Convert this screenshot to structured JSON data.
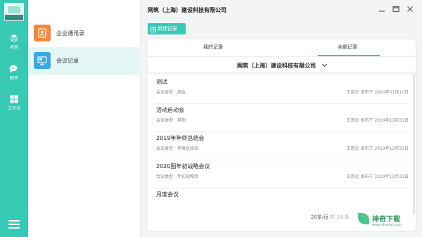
{
  "rail": {
    "items": [
      {
        "label": "项目",
        "icon": "layers-icon"
      },
      {
        "label": "聊天",
        "icon": "chat-icon"
      },
      {
        "label": "工作台",
        "icon": "grid-icon"
      }
    ],
    "menu_icon": "hamburger-icon",
    "accent": "#38c9b4"
  },
  "sidebar": {
    "items": [
      {
        "label": "企业通讯录",
        "icon": "contact-book-icon",
        "color": "#f0883e"
      },
      {
        "label": "会议记录",
        "icon": "meeting-icon",
        "color": "#3aa9e0"
      }
    ],
    "active_index": 1
  },
  "window": {
    "title": "网筑（上海）建设科技有限公司",
    "controls": {
      "minimize": "minimize-icon",
      "maximize": "maximize-icon",
      "close": "close-icon"
    }
  },
  "toolbar": {
    "new_label": "新建记录"
  },
  "tabs": [
    {
      "label": "我的记录"
    },
    {
      "label": "全部记录"
    }
  ],
  "active_tab": 1,
  "company_selector": {
    "label": "网筑（上海）建设科技有限公司"
  },
  "records": [
    {
      "title": "测试",
      "type": "会议类型：周会",
      "meta": "王宪生 发布于 2020年01月10日"
    },
    {
      "title": "活动启动会",
      "type": "会议类型：其他",
      "meta": "王思远 发布于 2019年12月31日"
    },
    {
      "title": "2019年年终总结会",
      "type": "会议类型：年度总结会",
      "meta": "王思远 发布于 2019年12月31日"
    },
    {
      "title": "2020图年初战略会议",
      "type": "会议类型：年初战略会",
      "meta": "王思远 发布于 2019年12月31日"
    },
    {
      "title": "月度会议",
      "type": "",
      "meta": ""
    }
  ],
  "pager": {
    "page_size": "20条/页",
    "total": "共 18 条"
  },
  "watermark": {
    "text": "神奇下载",
    "sub": "www.shenqi.com"
  }
}
